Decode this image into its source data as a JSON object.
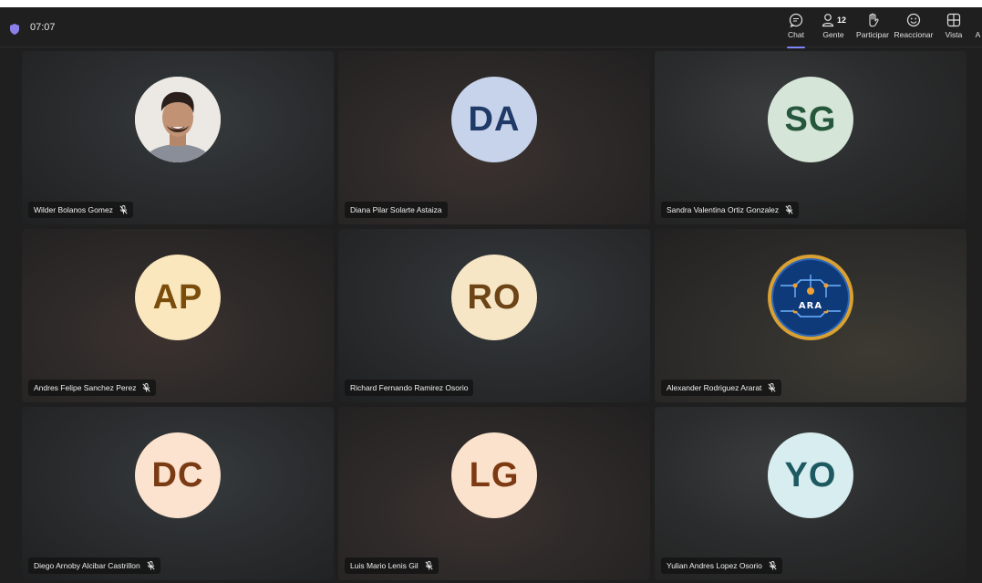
{
  "meeting": {
    "timer": "07:07"
  },
  "toolbar": {
    "chat_label": "Chat",
    "people_label": "Gente",
    "people_count": "12",
    "raise_label": "Participar",
    "react_label": "Reaccionar",
    "view_label": "Vista",
    "more_label": "A"
  },
  "colors": {
    "accent": "#7f85f5",
    "shield": "#8b7fe8"
  },
  "participants": [
    {
      "name": "Wilder Bolanos Gomez",
      "initials": "",
      "muted": true,
      "avatar_type": "photo"
    },
    {
      "name": "Diana Pilar Solarte Astaiza",
      "initials": "DA",
      "muted": false,
      "avatar_bg": "#c7d3ea",
      "avatar_fg": "#1f3a66"
    },
    {
      "name": "Sandra Valentina Ortiz Gonzalez",
      "initials": "SG",
      "muted": true,
      "avatar_bg": "#d5e6d9",
      "avatar_fg": "#27573b"
    },
    {
      "name": "Andres Felipe Sanchez Perez",
      "initials": "AP",
      "muted": true,
      "avatar_bg": "#fbe7bd",
      "avatar_fg": "#7a4d0c"
    },
    {
      "name": "Richard Fernando Ramirez Osorio",
      "initials": "RO",
      "muted": false,
      "avatar_bg": "#f7e6c6",
      "avatar_fg": "#6d4415"
    },
    {
      "name": "Alexander Rodriguez Ararat",
      "initials": "ARA",
      "muted": true,
      "avatar_type": "logo"
    },
    {
      "name": "Diego Arnoby Alcibar Castrillon",
      "initials": "DC",
      "muted": true,
      "avatar_bg": "#fbe3cf",
      "avatar_fg": "#7a3a14"
    },
    {
      "name": "Luis Mario Lenis Gil",
      "initials": "LG",
      "muted": true,
      "avatar_bg": "#fbe2cc",
      "avatar_fg": "#7d3a12"
    },
    {
      "name": "Yulian Andres Lopez Osorio",
      "initials": "YO",
      "muted": true,
      "avatar_bg": "#d7edf0",
      "avatar_fg": "#1d5961"
    }
  ]
}
